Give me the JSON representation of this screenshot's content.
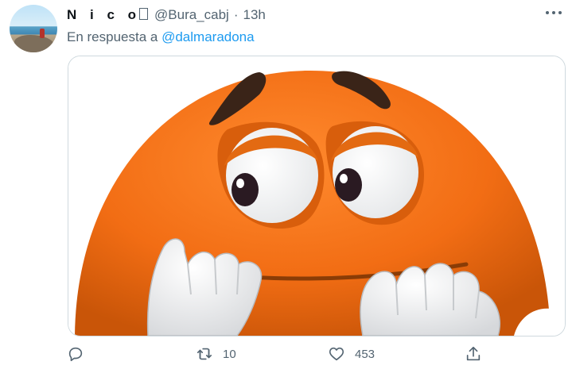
{
  "tweet": {
    "author": {
      "display_name": "N i c o",
      "verified_glyph": "",
      "handle": "@Bura_cabj",
      "separator": "·",
      "time": "13h",
      "avatar_icon": "beach-photo-avatar"
    },
    "reply_to": {
      "prefix": "En respuesta a",
      "mention": "@dalmaradona"
    },
    "media": {
      "description_icon": "worried-orange-candy-character-image"
    },
    "actions": {
      "reply": {
        "icon": "reply-icon"
      },
      "retweet": {
        "icon": "retweet-icon",
        "count": "10"
      },
      "like": {
        "icon": "heart-icon",
        "count": "453"
      },
      "share": {
        "icon": "share-icon"
      }
    },
    "more_icon": "more-options-icon"
  },
  "colors": {
    "link": "#1d9bf0",
    "secondary_text": "#536471",
    "border": "#cfd9de",
    "orange": "#f26d14"
  }
}
